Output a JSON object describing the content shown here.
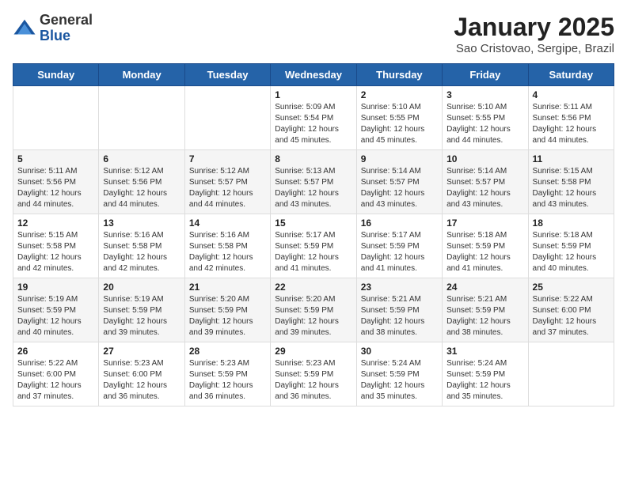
{
  "header": {
    "logo_general": "General",
    "logo_blue": "Blue",
    "title": "January 2025",
    "subtitle": "Sao Cristovao, Sergipe, Brazil"
  },
  "days_of_week": [
    "Sunday",
    "Monday",
    "Tuesday",
    "Wednesday",
    "Thursday",
    "Friday",
    "Saturday"
  ],
  "weeks": [
    [
      {
        "day": "",
        "info": ""
      },
      {
        "day": "",
        "info": ""
      },
      {
        "day": "",
        "info": ""
      },
      {
        "day": "1",
        "info": "Sunrise: 5:09 AM\nSunset: 5:54 PM\nDaylight: 12 hours and 45 minutes."
      },
      {
        "day": "2",
        "info": "Sunrise: 5:10 AM\nSunset: 5:55 PM\nDaylight: 12 hours and 45 minutes."
      },
      {
        "day": "3",
        "info": "Sunrise: 5:10 AM\nSunset: 5:55 PM\nDaylight: 12 hours and 44 minutes."
      },
      {
        "day": "4",
        "info": "Sunrise: 5:11 AM\nSunset: 5:56 PM\nDaylight: 12 hours and 44 minutes."
      }
    ],
    [
      {
        "day": "5",
        "info": "Sunrise: 5:11 AM\nSunset: 5:56 PM\nDaylight: 12 hours and 44 minutes."
      },
      {
        "day": "6",
        "info": "Sunrise: 5:12 AM\nSunset: 5:56 PM\nDaylight: 12 hours and 44 minutes."
      },
      {
        "day": "7",
        "info": "Sunrise: 5:12 AM\nSunset: 5:57 PM\nDaylight: 12 hours and 44 minutes."
      },
      {
        "day": "8",
        "info": "Sunrise: 5:13 AM\nSunset: 5:57 PM\nDaylight: 12 hours and 43 minutes."
      },
      {
        "day": "9",
        "info": "Sunrise: 5:14 AM\nSunset: 5:57 PM\nDaylight: 12 hours and 43 minutes."
      },
      {
        "day": "10",
        "info": "Sunrise: 5:14 AM\nSunset: 5:57 PM\nDaylight: 12 hours and 43 minutes."
      },
      {
        "day": "11",
        "info": "Sunrise: 5:15 AM\nSunset: 5:58 PM\nDaylight: 12 hours and 43 minutes."
      }
    ],
    [
      {
        "day": "12",
        "info": "Sunrise: 5:15 AM\nSunset: 5:58 PM\nDaylight: 12 hours and 42 minutes."
      },
      {
        "day": "13",
        "info": "Sunrise: 5:16 AM\nSunset: 5:58 PM\nDaylight: 12 hours and 42 minutes."
      },
      {
        "day": "14",
        "info": "Sunrise: 5:16 AM\nSunset: 5:58 PM\nDaylight: 12 hours and 42 minutes."
      },
      {
        "day": "15",
        "info": "Sunrise: 5:17 AM\nSunset: 5:59 PM\nDaylight: 12 hours and 41 minutes."
      },
      {
        "day": "16",
        "info": "Sunrise: 5:17 AM\nSunset: 5:59 PM\nDaylight: 12 hours and 41 minutes."
      },
      {
        "day": "17",
        "info": "Sunrise: 5:18 AM\nSunset: 5:59 PM\nDaylight: 12 hours and 41 minutes."
      },
      {
        "day": "18",
        "info": "Sunrise: 5:18 AM\nSunset: 5:59 PM\nDaylight: 12 hours and 40 minutes."
      }
    ],
    [
      {
        "day": "19",
        "info": "Sunrise: 5:19 AM\nSunset: 5:59 PM\nDaylight: 12 hours and 40 minutes."
      },
      {
        "day": "20",
        "info": "Sunrise: 5:19 AM\nSunset: 5:59 PM\nDaylight: 12 hours and 39 minutes."
      },
      {
        "day": "21",
        "info": "Sunrise: 5:20 AM\nSunset: 5:59 PM\nDaylight: 12 hours and 39 minutes."
      },
      {
        "day": "22",
        "info": "Sunrise: 5:20 AM\nSunset: 5:59 PM\nDaylight: 12 hours and 39 minutes."
      },
      {
        "day": "23",
        "info": "Sunrise: 5:21 AM\nSunset: 5:59 PM\nDaylight: 12 hours and 38 minutes."
      },
      {
        "day": "24",
        "info": "Sunrise: 5:21 AM\nSunset: 5:59 PM\nDaylight: 12 hours and 38 minutes."
      },
      {
        "day": "25",
        "info": "Sunrise: 5:22 AM\nSunset: 6:00 PM\nDaylight: 12 hours and 37 minutes."
      }
    ],
    [
      {
        "day": "26",
        "info": "Sunrise: 5:22 AM\nSunset: 6:00 PM\nDaylight: 12 hours and 37 minutes."
      },
      {
        "day": "27",
        "info": "Sunrise: 5:23 AM\nSunset: 6:00 PM\nDaylight: 12 hours and 36 minutes."
      },
      {
        "day": "28",
        "info": "Sunrise: 5:23 AM\nSunset: 5:59 PM\nDaylight: 12 hours and 36 minutes."
      },
      {
        "day": "29",
        "info": "Sunrise: 5:23 AM\nSunset: 5:59 PM\nDaylight: 12 hours and 36 minutes."
      },
      {
        "day": "30",
        "info": "Sunrise: 5:24 AM\nSunset: 5:59 PM\nDaylight: 12 hours and 35 minutes."
      },
      {
        "day": "31",
        "info": "Sunrise: 5:24 AM\nSunset: 5:59 PM\nDaylight: 12 hours and 35 minutes."
      },
      {
        "day": "",
        "info": ""
      }
    ]
  ],
  "colors": {
    "header_bg": "#2563a8",
    "header_text": "#ffffff",
    "accent": "#1a56a0"
  }
}
